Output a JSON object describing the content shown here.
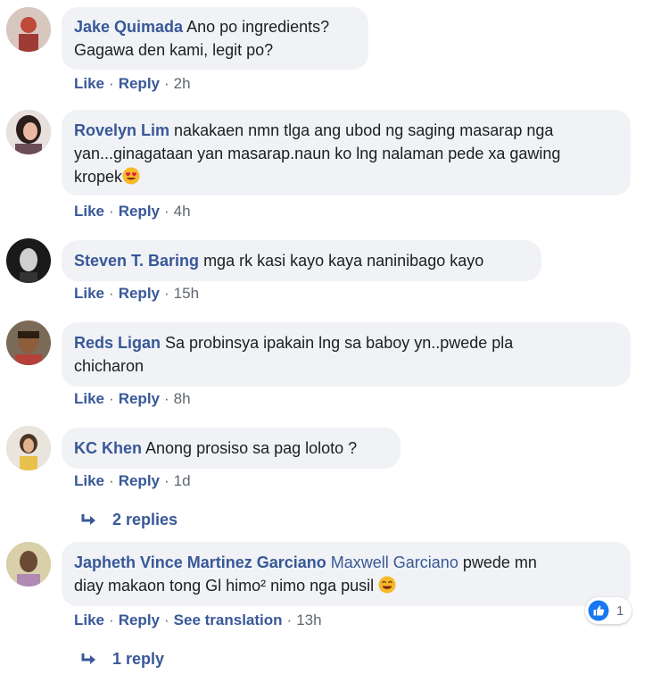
{
  "comments": [
    {
      "author": "Jake Quimada",
      "text": "Ano po ingredients?",
      "text2": "Gagawa den kami, legit po?",
      "like": "Like",
      "reply": "Reply",
      "time": "2h"
    },
    {
      "author": "Rovelyn Lim",
      "text": "nakakaen nmn tlga ang ubod ng saging masarap nga",
      "text2": "yan...ginagataan yan masarap.naun ko lng nalaman pede xa gawing",
      "text3": "kropek",
      "like": "Like",
      "reply": "Reply",
      "time": "4h"
    },
    {
      "author": "Steven T. Baring",
      "text": "mga rk kasi kayo kaya naninibago kayo",
      "like": "Like",
      "reply": "Reply",
      "time": "15h"
    },
    {
      "author": "Reds Ligan",
      "text": "Sa probinsya ipakain lng sa baboy yn..pwede pla",
      "text2": "chicharon",
      "like": "Like",
      "reply": "Reply",
      "time": "8h"
    },
    {
      "author": "KC Khen",
      "text": "Anong prosiso sa pag loloto ?",
      "like": "Like",
      "reply": "Reply",
      "time": "1d",
      "replies": "2 replies"
    },
    {
      "author": "Japheth Vince Martinez Garciano",
      "mention": "Maxwell Garciano",
      "text": "pwede mn",
      "text2": "diay makaon tong Gl himo² nimo nga pusil",
      "like": "Like",
      "reply": "Reply",
      "translate": "See translation",
      "time": "13h",
      "replies": "1 reply",
      "reaction_count": "1"
    }
  ],
  "separator": "·",
  "colors": {
    "link": "#385898",
    "bubble": "#f0f2f5",
    "meta": "#606770",
    "like_blue": "#1877f2"
  },
  "icons": [
    "reply-arrow-icon",
    "emoji-heart-eyes-icon",
    "emoji-smile-icon",
    "like-reaction-icon"
  ]
}
